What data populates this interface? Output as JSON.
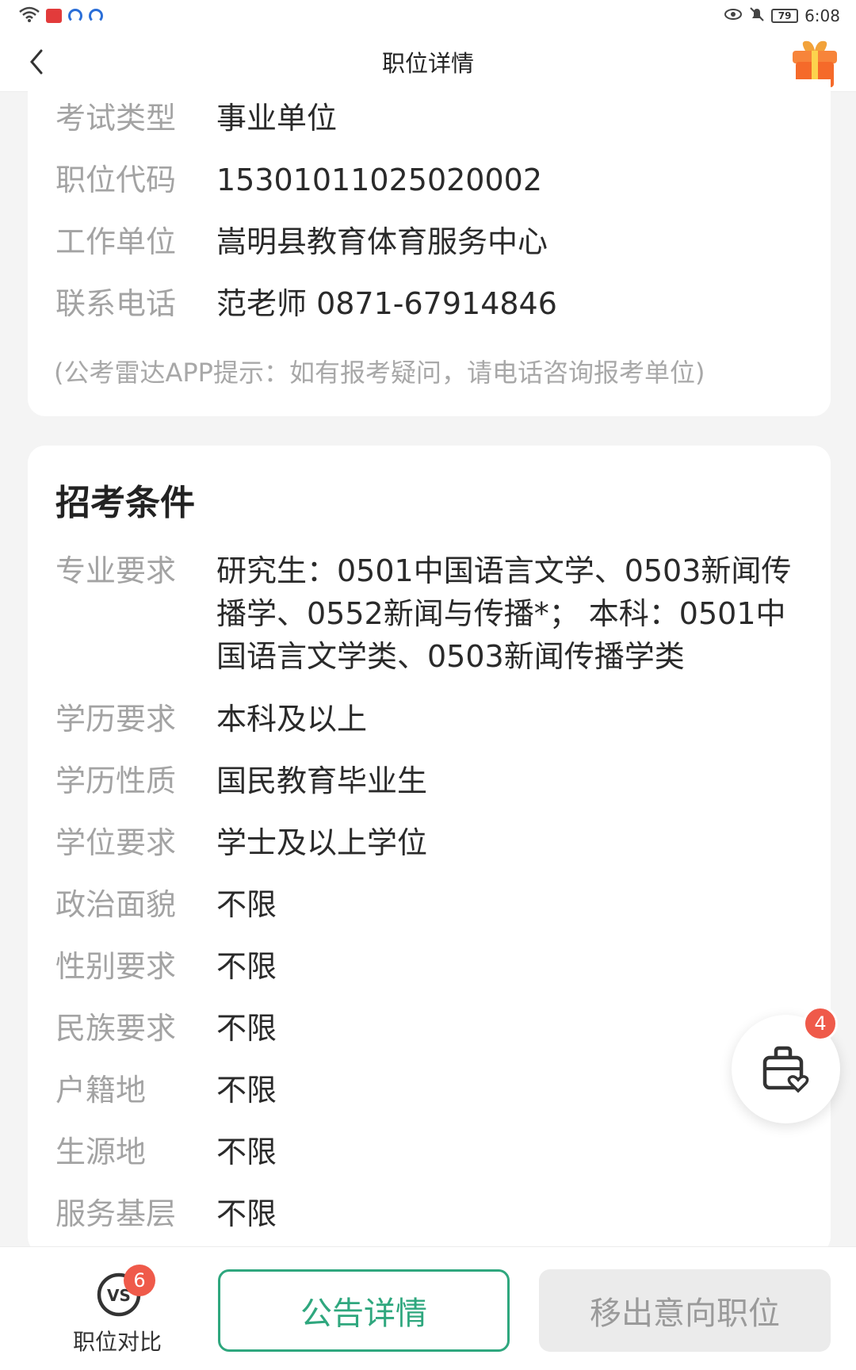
{
  "status_bar": {
    "time": "6:08",
    "battery": "79"
  },
  "header": {
    "title": "职位详情"
  },
  "basic_info": {
    "rows": [
      {
        "label": "考试类型",
        "value": "事业单位"
      },
      {
        "label": "职位代码",
        "value": "1530101102502000​2"
      },
      {
        "label": "工作单位",
        "value": "嵩明县教育体育服务中心"
      },
      {
        "label": "联系电话",
        "value": "范老师 0871-67914846"
      }
    ],
    "hint": "(公考雷达APP提示：如有报考疑问，请电话咨询报考单位)"
  },
  "conditions": {
    "title": "招考条件",
    "rows": [
      {
        "label": "专业要求",
        "value": "研究生：0501中国语言文学、0503新闻传播学、0552新闻与传播*； 本科：0501中国语言文学类、0503新闻传播学类"
      },
      {
        "label": "学历要求",
        "value": "本科及以上"
      },
      {
        "label": "学历性质",
        "value": "国民教育毕业生"
      },
      {
        "label": "学位要求",
        "value": "学士及以上学位"
      },
      {
        "label": "政治面貌",
        "value": "不限"
      },
      {
        "label": "性别要求",
        "value": "不限"
      },
      {
        "label": "民族要求",
        "value": "不限"
      },
      {
        "label": "户籍地",
        "value": "不限"
      },
      {
        "label": "生源地",
        "value": "不限"
      },
      {
        "label": "服务基层",
        "value": "不限"
      }
    ]
  },
  "float_basket": {
    "count": "4"
  },
  "bottom_bar": {
    "compare_label": "职位对比",
    "compare_count": "6",
    "notice_label": "公告详情",
    "remove_label": "移出意向职位"
  },
  "colors": {
    "accent": "#2fa77e",
    "badge": "#ef5a4a"
  }
}
